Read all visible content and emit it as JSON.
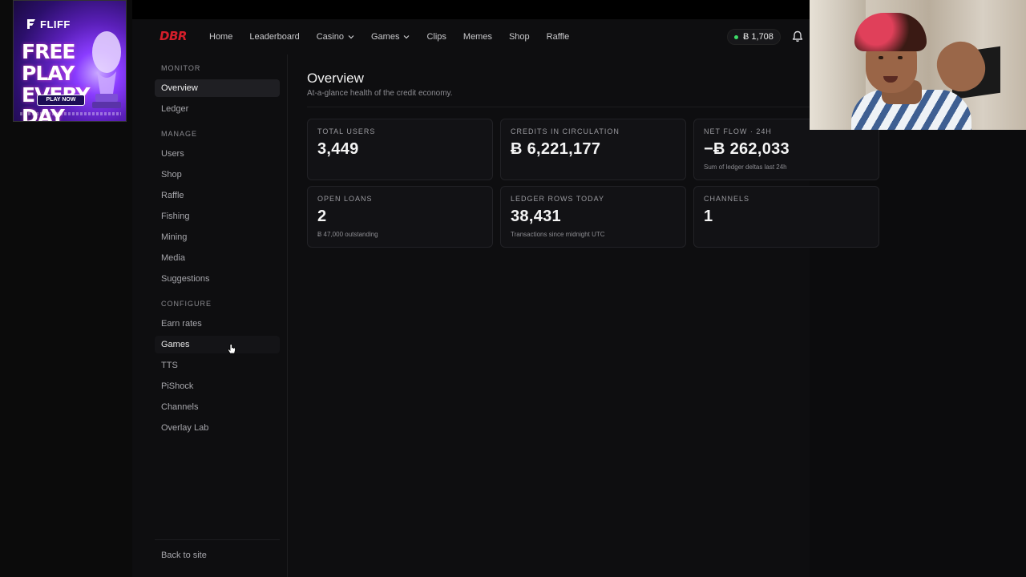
{
  "ad": {
    "brand": "FLIFF",
    "headline": "FREE PLAY EVERY DAY",
    "cta": "PLAY NOW"
  },
  "topnav": {
    "logo": "DBR",
    "items": [
      {
        "label": "Home",
        "has_chevron": false
      },
      {
        "label": "Leaderboard",
        "has_chevron": false
      },
      {
        "label": "Casino",
        "has_chevron": true
      },
      {
        "label": "Games",
        "has_chevron": true
      },
      {
        "label": "Clips",
        "has_chevron": false
      },
      {
        "label": "Memes",
        "has_chevron": false
      },
      {
        "label": "Shop",
        "has_chevron": false
      },
      {
        "label": "Raffle",
        "has_chevron": false
      }
    ],
    "balance": "Ƀ 1,708",
    "balance_status_color": "#3ddc68"
  },
  "sidebar": {
    "sections": [
      {
        "label": "MONITOR",
        "items": [
          "Overview",
          "Ledger"
        ]
      },
      {
        "label": "MANAGE",
        "items": [
          "Users",
          "Shop",
          "Raffle",
          "Fishing",
          "Mining",
          "Media",
          "Suggestions"
        ]
      },
      {
        "label": "CONFIGURE",
        "items": [
          "Earn rates",
          "Games",
          "TTS",
          "PiShock",
          "Channels",
          "Overlay Lab"
        ]
      }
    ],
    "active_item": "Overview",
    "hovered_item": "Games",
    "footer_link": "Back to site"
  },
  "main": {
    "title": "Overview",
    "subtitle": "At-a-glance health of the credit economy.",
    "cards": [
      {
        "label": "TOTAL USERS",
        "value": "3,449",
        "note": ""
      },
      {
        "label": "CREDITS IN CIRCULATION",
        "value": "Ƀ 6,221,177",
        "note": ""
      },
      {
        "label": "NET FLOW · 24H",
        "value": "−Ƀ 262,033",
        "note": "Sum of ledger deltas last 24h"
      },
      {
        "label": "OPEN LOANS",
        "value": "2",
        "note": "Ƀ 47,000 outstanding"
      },
      {
        "label": "LEDGER ROWS TODAY",
        "value": "38,431",
        "note": "Transactions since midnight UTC"
      },
      {
        "label": "CHANNELS",
        "value": "1",
        "note": ""
      }
    ]
  },
  "colors": {
    "background": "#0e0e10",
    "card": "#121215",
    "logo_red": "#d41e2a",
    "text_primary": "#f2f2f2",
    "text_muted": "#8d8d92"
  }
}
